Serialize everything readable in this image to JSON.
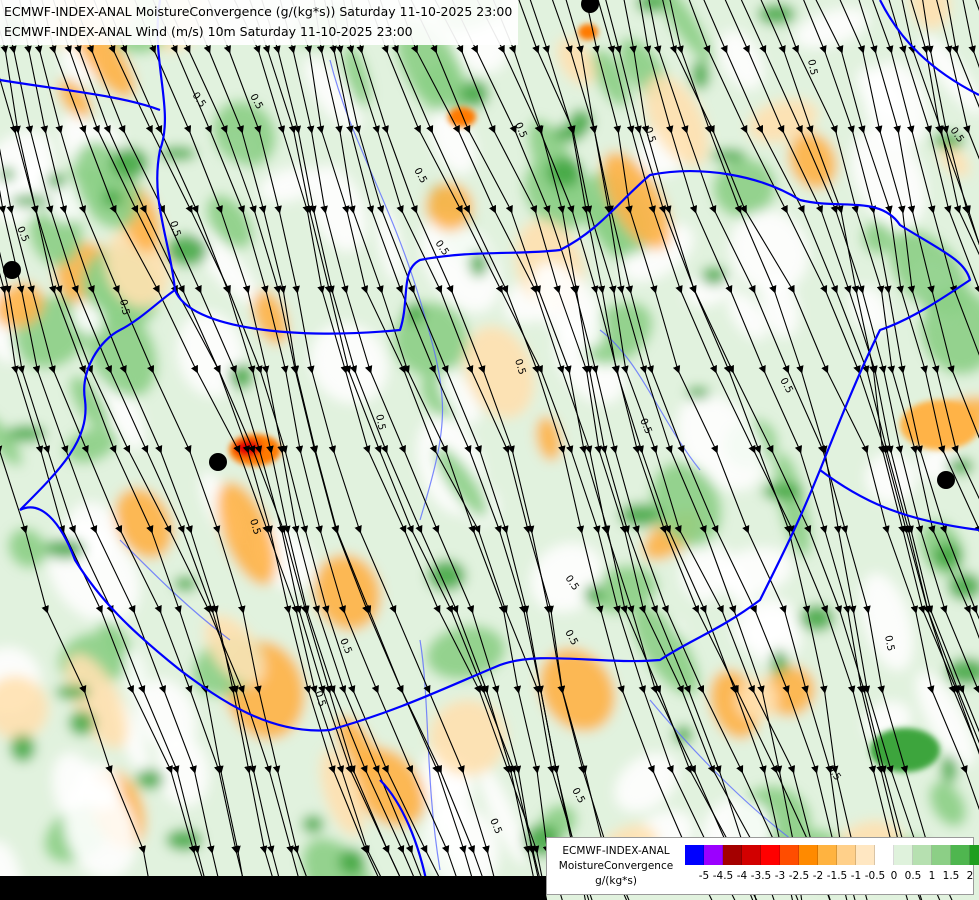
{
  "header": {
    "line1": "ECMWF-INDEX-ANAL MoistureConvergence (g/(kg*s)) Saturday 11-10-2025 23:00",
    "line2": "ECMWF-INDEX-ANAL Wind (m/s) 10m Saturday 11-10-2025 23:00"
  },
  "legend": {
    "model": "ECMWF-INDEX-ANAL",
    "variable": "MoistureConvergence",
    "unit": "g/(kg*s)",
    "swatches": [
      "#0000ff",
      "#9b00ff",
      "#a40000",
      "#d20000",
      "#ff0000",
      "#ff4d00",
      "#ff8a00",
      "#ffb340",
      "#ffd08a",
      "#ffe7c2",
      "#ffffff",
      "#dff2dc",
      "#b6e0b0",
      "#8ccf86",
      "#4fb64f",
      "#1e9e1e"
    ],
    "ticks": [
      "-5",
      "-4.5",
      "-4",
      "-3.5",
      "-3",
      "-2.5",
      "-2",
      "-1.5",
      "-1",
      "-0.5",
      "0",
      "0.5",
      "1",
      "1.5",
      "2"
    ]
  },
  "map": {
    "contour_labels": [
      "0.5",
      "0.5",
      "0.5",
      "0.5",
      "0.5",
      "0.5",
      "0.5",
      "0.5",
      "0.5",
      "0.5",
      "0.5",
      "0.5",
      "0.5",
      "0.5",
      "0.5",
      "0.5",
      "0.5",
      "0.5",
      "0.5",
      "0.5",
      "0.5",
      "0.5",
      "0.5",
      "0.5"
    ],
    "colors": {
      "green_light": "#c8e8c2",
      "green_mid": "#8ccf86",
      "green_dark": "#3da53d",
      "orange_light": "#ffe1b0",
      "orange_mid": "#ffb347",
      "orange_dark": "#ff7a00",
      "red": "#e60000",
      "border": "#0000ff",
      "river": "#5b6bff",
      "streamline": "#000000"
    }
  }
}
